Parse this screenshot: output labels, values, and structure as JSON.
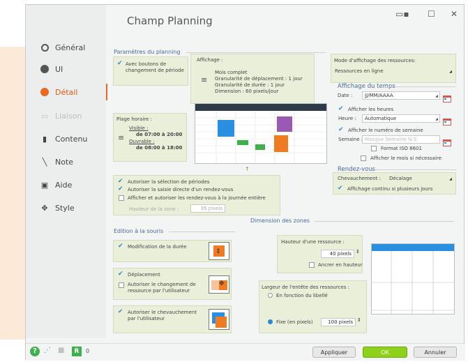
{
  "window": {
    "title": "Champ Planning"
  },
  "sidebar": {
    "items": [
      {
        "label": "Général"
      },
      {
        "label": "UI"
      },
      {
        "label": "Détail"
      },
      {
        "label": "Liaison"
      },
      {
        "label": "Contenu"
      },
      {
        "label": "Note"
      },
      {
        "label": "Aide"
      },
      {
        "label": "Style"
      }
    ]
  },
  "planning_params": {
    "section": "Paramètres du planning",
    "period_buttons": "Avec boutons de",
    "period_buttons2": "changement de période",
    "affichage_label": "Affichage :",
    "affichage_lines": [
      "Mois complet",
      "Granularité de déplacement : 1 jour",
      "Granularité de durée : 1 jour",
      "Dimension : 60 pixels/jour"
    ],
    "plage_label": "Plage horaire :",
    "visible": "Visible :",
    "visible_range": "de 07:00 à 20:00",
    "ouvrable": "Ouvrable :",
    "ouvrable_range": "de 08:00 à 18:00"
  },
  "resources": {
    "mode_label": "Mode d'affichage des ressources:",
    "mode_value": "Ressources en ligne"
  },
  "time_display": {
    "section": "Affichage du temps",
    "date_label": "Date :",
    "date_value": "JJ/MM/AAAA",
    "show_hours": "Afficher les heures",
    "hour_label": "Heure :",
    "hour_value": "Automatique",
    "show_week": "Afficher le numéro de semaine",
    "week_label": "Semaine :",
    "week_placeholder": "Masque Semaine N.S",
    "iso": "Format ISO 8601",
    "show_month": "Afficher le mois si nécessaire"
  },
  "rendezvous": {
    "section": "Rendez-vous",
    "overlap_label": "Chevauchement :",
    "overlap_value": "Décalage",
    "continuous": "Affichage continu si plusieurs jours"
  },
  "period_options": {
    "allow_select": "Autoriser la sélection de périodes",
    "allow_direct": "Autoriser la saisie directe d'un rendez-vous",
    "allow_allday": "Afficher et autoriser les rendez-vous à la journée entière",
    "zone_height": "Hauteur de la zone :",
    "zone_height_value": "35 pixels"
  },
  "zones": {
    "section": "Dimension des zones",
    "res_height_label": "Hauteur d'une ressource :",
    "res_height_value": "40 pixels",
    "anchor": "Ancrer en hauteur",
    "header_width_label": "Largeur de l'entête des ressources :",
    "by_label": "En fonction du libellé",
    "fixed": "Fixe (en pixels)",
    "fixed_value": "100 pixels"
  },
  "mouse_edit": {
    "section": "Edition à la souris",
    "duration": "Modification de la durée",
    "move": "Déplacement",
    "change_res": "Autoriser le changement de",
    "change_res2": "ressource par l'utilisateur",
    "overlap": "Autoriser le chevauchement",
    "overlap2": "par l'utilisateur"
  },
  "footer": {
    "apply": "Appliquer",
    "ok": "OK",
    "cancel": "Annuler",
    "counter": "0"
  },
  "colors": {
    "accent": "#e8691f",
    "panel": "#e9efd9",
    "check": "#2b88d8",
    "ok": "#8ed11a"
  }
}
